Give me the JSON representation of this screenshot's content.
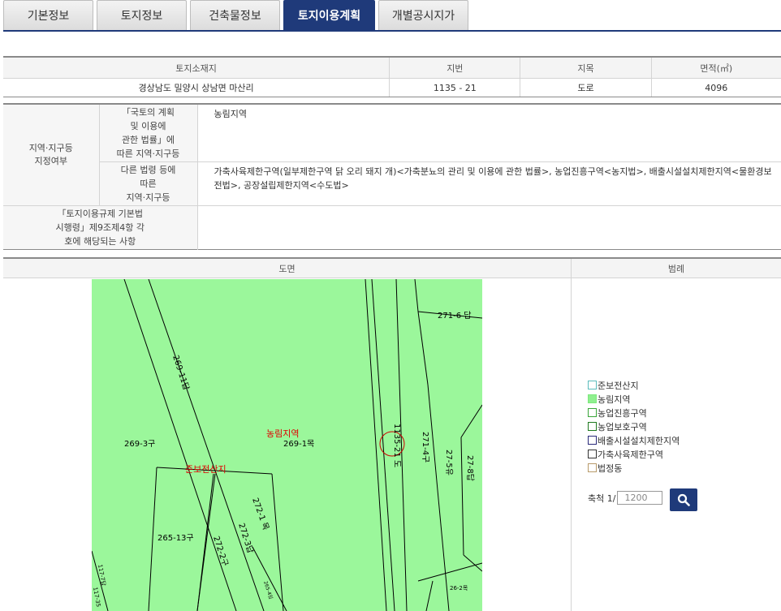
{
  "tabs": [
    "기본정보",
    "토지정보",
    "건축물정보",
    "토지이용계획",
    "개별공시지가"
  ],
  "land": {
    "headers": [
      "토지소재지",
      "지번",
      "지목",
      "면적(㎡)"
    ],
    "row": [
      "경상남도 밀양시 상남면 마산리",
      "1135 - 21",
      "도로",
      "4096"
    ]
  },
  "zoning": {
    "main_label": "지역·지구등\n지정여부",
    "sub1_label": "「국토의 계획\n및 이용에\n관한 법률」에\n따른 지역·지구등",
    "sub1_value": "농림지역",
    "sub2_label": "다른 법령 등에\n따른\n지역·지구등",
    "sub2_value": "가축사육제한구역(일부제한구역 닭 오리 돼지 개)<가축분뇨의 관리 및 이용에 관한 법률>, 농업진흥구역<농지법>, 배출시설설치제한지역<물환경보전법>, 공장설립제한지역<수도법>",
    "row3_label": "「토지이용규제 기본법\n시행령」제9조제4항 각\n호에 해당되는 사항",
    "row3_value": ""
  },
  "map": {
    "header": "도면",
    "legend_header": "범례",
    "labels": {
      "l271_6": "271-6 답",
      "l269_11": "269-11답",
      "l269_3": "269-3구",
      "l269_1": "269-1목",
      "zone": "농림지역",
      "subject": "1135-21 도",
      "l271_4": "271-4구",
      "l27_5": "27-5유",
      "l27_8": "27-8답",
      "preserve": "준보전산지",
      "l272_1": "272-1 목",
      "l272_3": "272-3답",
      "l265_13": "265-13구",
      "l272_2": "272-2구",
      "l265": "265-4임",
      "l26_2": "26-2목",
      "l117": "117-7답",
      "l117b": "117-35"
    }
  },
  "legend": [
    {
      "label": "준보전산지",
      "border": "#5bbcbc",
      "fill": "#ffffff"
    },
    {
      "label": "농림지역",
      "border": "#7de87d",
      "fill": "#8ff08f"
    },
    {
      "label": "농업진흥구역",
      "border": "#3aa53a",
      "fill": "#ffffff"
    },
    {
      "label": "농업보호구역",
      "border": "#1f7a1f",
      "fill": "#ffffff"
    },
    {
      "label": "배출시설설치제한지역",
      "border": "#2a2a7a",
      "fill": "#ffffff"
    },
    {
      "label": "가축사육제한구역",
      "border": "#333333",
      "fill": "#ffffff"
    },
    {
      "label": "법정동",
      "border": "#b89a6a",
      "fill": "#ffffff"
    }
  ],
  "scale": {
    "label": "축척 1/",
    "value": "1200"
  }
}
